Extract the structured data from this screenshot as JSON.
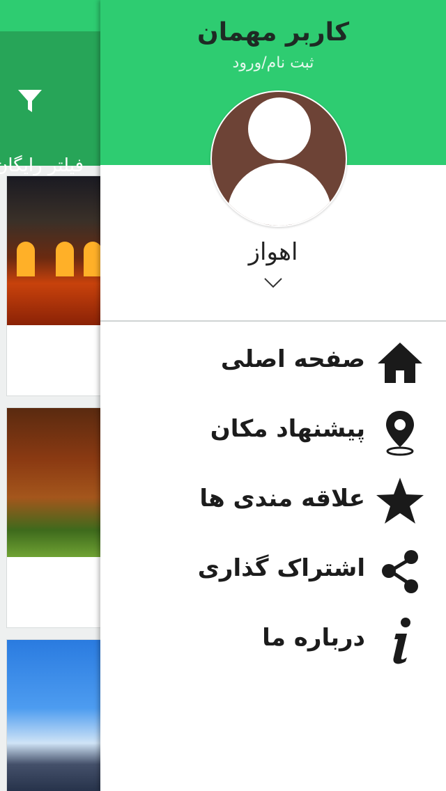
{
  "background_app": {
    "filter_label": "فیلتر رایگان",
    "filter_icon": "filter-icon"
  },
  "drawer": {
    "user_name": "کاربر مهمان",
    "auth_link": "ثبت نام/ورود",
    "avatar_icon": "user-avatar-icon",
    "city": "اهواز",
    "city_dropdown_icon": "chevron-down-icon",
    "menu": [
      {
        "label": "صفحه اصلی",
        "icon": "home-icon"
      },
      {
        "label": "پیشنهاد مکان",
        "icon": "location-pin-icon"
      },
      {
        "label": "علاقه مندی ها",
        "icon": "star-icon"
      },
      {
        "label": "اشتراک گذاری",
        "icon": "share-icon"
      },
      {
        "label": "درباره ما",
        "icon": "info-icon"
      }
    ]
  },
  "colors": {
    "primary": "#2ecc71",
    "primary_dark": "#27a558",
    "avatar_bg": "#6d4336",
    "text": "#1c1c1c"
  }
}
